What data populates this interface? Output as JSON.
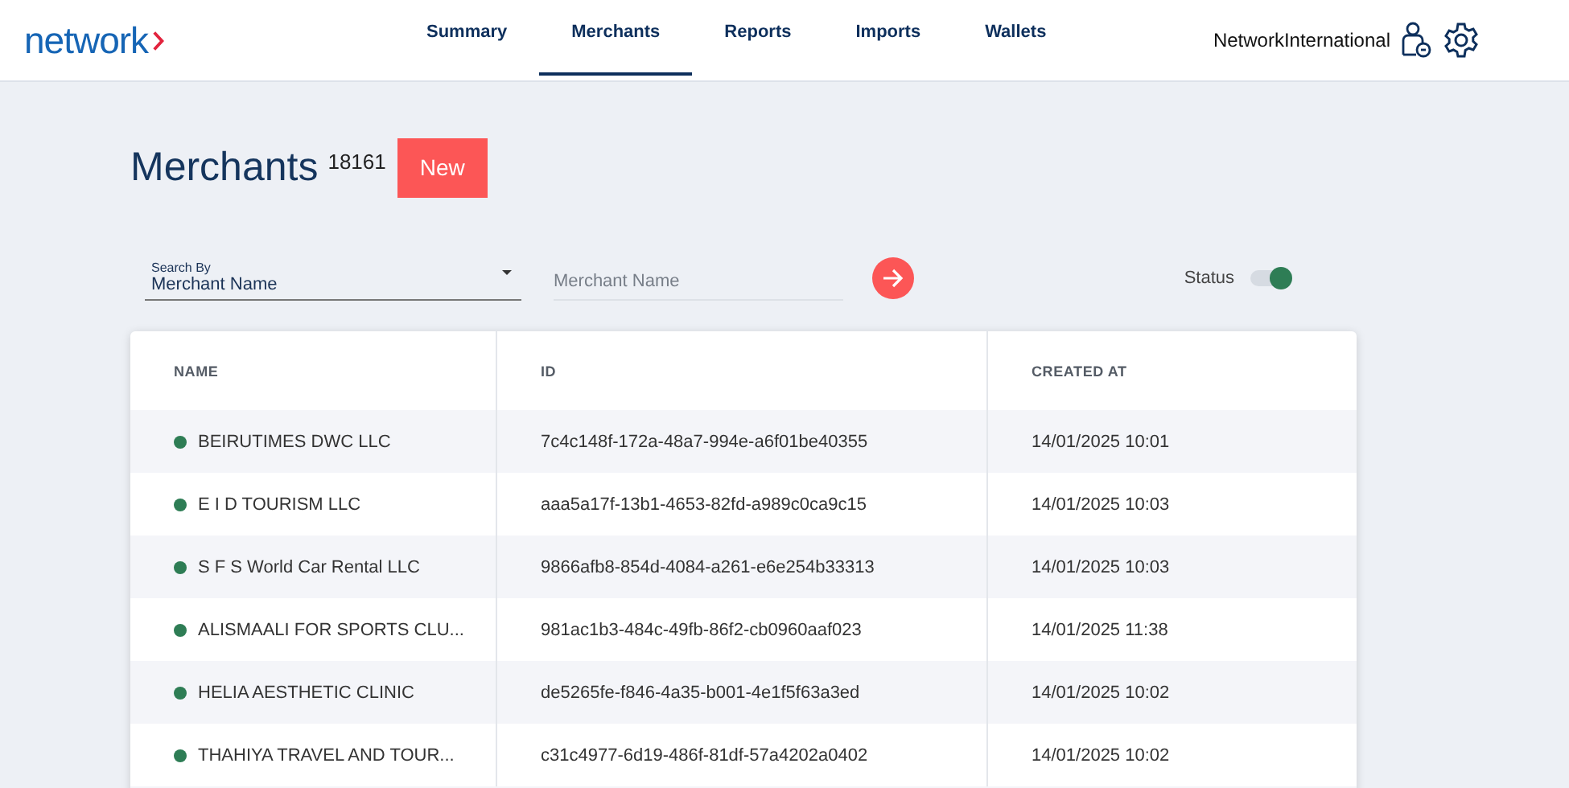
{
  "header": {
    "logo": "network",
    "nav": [
      {
        "label": "Summary",
        "selected": false
      },
      {
        "label": "Merchants",
        "selected": true
      },
      {
        "label": "Reports",
        "selected": false
      },
      {
        "label": "Imports",
        "selected": false
      },
      {
        "label": "Wallets",
        "selected": false
      }
    ],
    "user": "NetworkInternational"
  },
  "page": {
    "title": "Merchants",
    "count": "18161",
    "new_button": "New"
  },
  "filters": {
    "search_by_label": "Search By",
    "search_by_value": "Merchant Name",
    "search_placeholder": "Merchant Name",
    "status_label": "Status",
    "status_on": true
  },
  "table": {
    "columns": [
      "NAME",
      "ID",
      "CREATED AT"
    ],
    "rows": [
      {
        "name": "BEIRUTIMES DWC LLC",
        "id": "7c4c148f-172a-48a7-994e-a6f01be40355",
        "created_at": "14/01/2025 10:01",
        "color": "#2e7d55"
      },
      {
        "name": "E I D TOURISM LLC",
        "id": "aaa5a17f-13b1-4653-82fd-a989c0ca9c15",
        "created_at": "14/01/2025 10:03",
        "color": "#2e7d55"
      },
      {
        "name": "S F S World Car Rental LLC",
        "id": "9866afb8-854d-4084-a261-e6e254b33313",
        "created_at": "14/01/2025 10:03",
        "color": "#2e7d55"
      },
      {
        "name": "ALISMAALI FOR SPORTS CLU...",
        "id": "981ac1b3-484c-49fb-86f2-cb0960aaf023",
        "created_at": "14/01/2025 11:38",
        "color": "#2e7d55"
      },
      {
        "name": "HELIA AESTHETIC CLINIC",
        "id": "de5265fe-f846-4a35-b001-4e1f5f63a3ed",
        "created_at": "14/01/2025 10:02",
        "color": "#2e7d55"
      },
      {
        "name": "THAHIYA TRAVEL AND TOUR...",
        "id": "c31c4977-6d19-486f-81df-57a4202a0402",
        "created_at": "14/01/2025 10:02",
        "color": "#2e7d55"
      }
    ]
  }
}
